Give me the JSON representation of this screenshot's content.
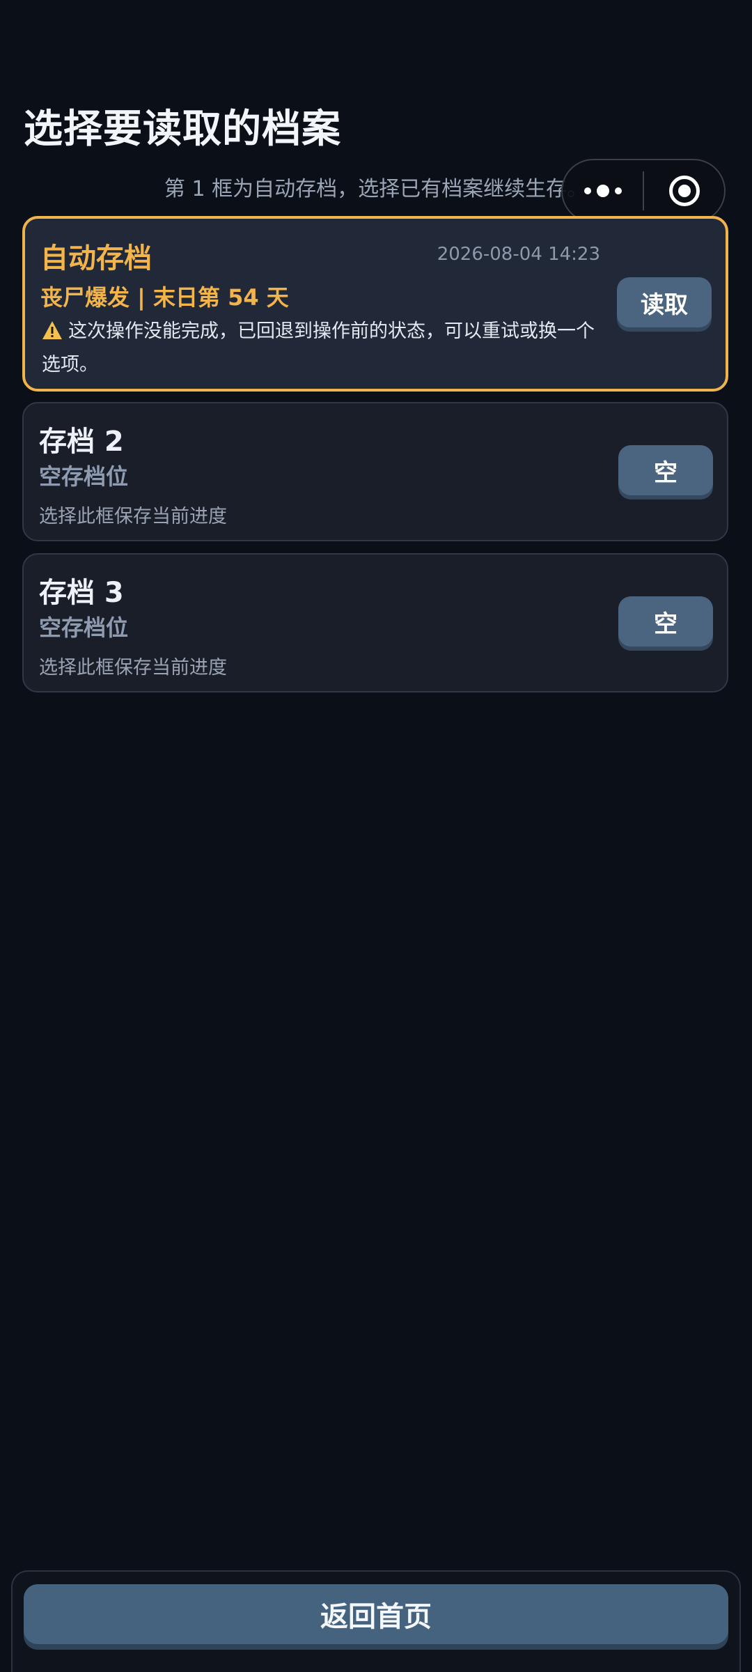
{
  "page": {
    "title": "选择要读取的档案",
    "subtitle": "第 1 框为自动存档，选择已有档案继续生存。"
  },
  "slots": [
    {
      "title": "自动存档",
      "timestamp": "2026-08-04 14:23",
      "status": "丧尸爆发 | 末日第 54 天",
      "warning": "这次操作没能完成，已回退到操作前的状态，可以重试或换一个选项。",
      "button_label": "读取"
    },
    {
      "title": "存档 2",
      "status": "空存档位",
      "description": "选择此框保存当前进度",
      "button_label": "空"
    },
    {
      "title": "存档 3",
      "status": "空存档位",
      "description": "选择此框保存当前进度",
      "button_label": "空"
    }
  ],
  "footer": {
    "home_label": "返回首页"
  },
  "colors": {
    "background": "#0b0f17",
    "accent": "#f2b44b",
    "button": "#4b6580"
  }
}
